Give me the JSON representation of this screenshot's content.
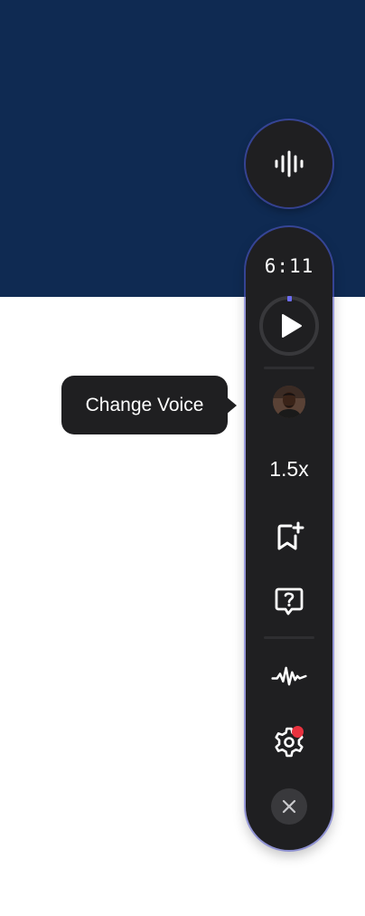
{
  "colors": {
    "banner": "#0f2a52",
    "panel": "#1f1f21",
    "accent_outline": "#585cd2",
    "progress_accent": "#6c6cf0",
    "notification": "#e8323f",
    "text": "#ffffff"
  },
  "voice_button": {
    "icon": "waveform-icon"
  },
  "player": {
    "time_remaining": "6:11",
    "progress": 0.0,
    "play_icon": "play-icon",
    "voice_avatar_icon": "voice-avatar",
    "speed": "1.5x",
    "bookmark_icon": "bookmark-add-icon",
    "help_icon": "question-bubble-icon",
    "audio_icon": "audio-wave-icon",
    "settings_icon": "gear-icon",
    "settings_has_notification": true,
    "close_icon": "close-icon"
  },
  "tooltip": {
    "text": "Change Voice"
  }
}
